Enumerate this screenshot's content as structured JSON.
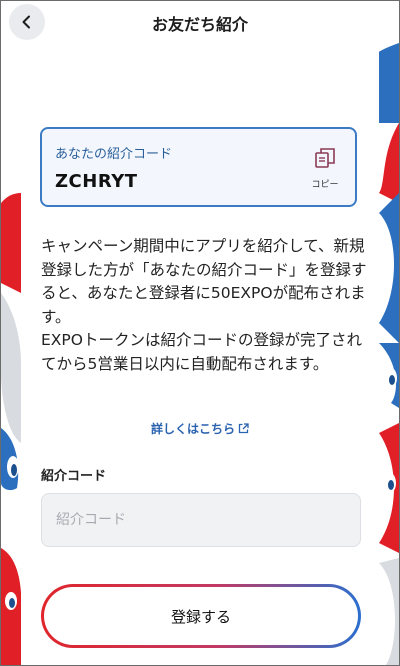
{
  "header": {
    "title": "お友だち紹介",
    "back_icon": "chevron-left-icon"
  },
  "referral_card": {
    "label": "あなたの紹介コード",
    "code": "ZCHRYT",
    "copy_label": "コピー",
    "copy_icon": "copy-icon"
  },
  "description": {
    "paragraph1": "キャンペーン期間中にアプリを紹介して、新規登録した方が「あなたの紹介コード」を登録すると、あなたと登録者に50EXPOが配布されます。",
    "paragraph2": "EXPOトークンは紹介コードの登録が完了されてから5営業日以内に自動配布されます。"
  },
  "details_link": {
    "label": "詳しくはこちら",
    "icon": "external-link-icon"
  },
  "form": {
    "label": "紹介コード",
    "placeholder": "紹介コード",
    "value": ""
  },
  "register_button": {
    "label": "登録する"
  },
  "colors": {
    "brand_red": "#e0252b",
    "brand_blue": "#2a6fcf",
    "card_border": "#3b7bc4",
    "link": "#2b63b0",
    "input_background": "#f1f2f4"
  }
}
